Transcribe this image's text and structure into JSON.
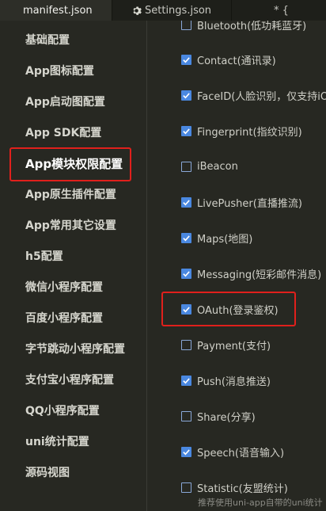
{
  "tabs": [
    {
      "label": "manifest.json",
      "active": true
    },
    {
      "label": "Settings.json",
      "icon": "gear-icon",
      "active": false
    },
    {
      "label": "* {",
      "active": false
    }
  ],
  "sidebar": {
    "items": [
      {
        "label": "基础配置",
        "selected": false
      },
      {
        "label": "App图标配置",
        "selected": false
      },
      {
        "label": "App启动图配置",
        "selected": false
      },
      {
        "label": "App SDK配置",
        "selected": false
      },
      {
        "label": "App模块权限配置",
        "selected": true
      },
      {
        "label": "App原生插件配置",
        "selected": false
      },
      {
        "label": "App常用其它设置",
        "selected": false
      },
      {
        "label": "h5配置",
        "selected": false
      },
      {
        "label": "微信小程序配置",
        "selected": false
      },
      {
        "label": "百度小程序配置",
        "selected": false
      },
      {
        "label": "字节跳动小程序配置",
        "selected": false
      },
      {
        "label": "支付宝小程序配置",
        "selected": false
      },
      {
        "label": "QQ小程序配置",
        "selected": false
      },
      {
        "label": "uni统计配置",
        "selected": false
      },
      {
        "label": "源码视图",
        "selected": false
      }
    ]
  },
  "modules": [
    {
      "label": "Bluetooth(低功耗蓝牙)",
      "checked": false
    },
    {
      "label": "Contact(通讯录)",
      "checked": true
    },
    {
      "label": "FaceID(人脸识别，仅支持iOS)",
      "checked": true
    },
    {
      "label": "Fingerprint(指纹识别)",
      "checked": true
    },
    {
      "label": "iBeacon",
      "checked": false
    },
    {
      "label": "LivePusher(直播推流)",
      "checked": true
    },
    {
      "label": "Maps(地图)",
      "checked": true
    },
    {
      "label": "Messaging(短彩邮件消息)",
      "checked": true
    },
    {
      "label": "OAuth(登录鉴权)",
      "checked": true
    },
    {
      "label": "Payment(支付)",
      "checked": false
    },
    {
      "label": "Push(消息推送)",
      "checked": true
    },
    {
      "label": "Share(分享)",
      "checked": false
    },
    {
      "label": "Speech(语音输入)",
      "checked": true
    },
    {
      "label": "Statistic(友盟统计)",
      "checked": false
    }
  ],
  "hint": "推荐使用uni-app自带的uni统计",
  "colors": {
    "highlight": "#e0201c",
    "checkbox_on": "#4a88e0",
    "background": "#272822"
  }
}
